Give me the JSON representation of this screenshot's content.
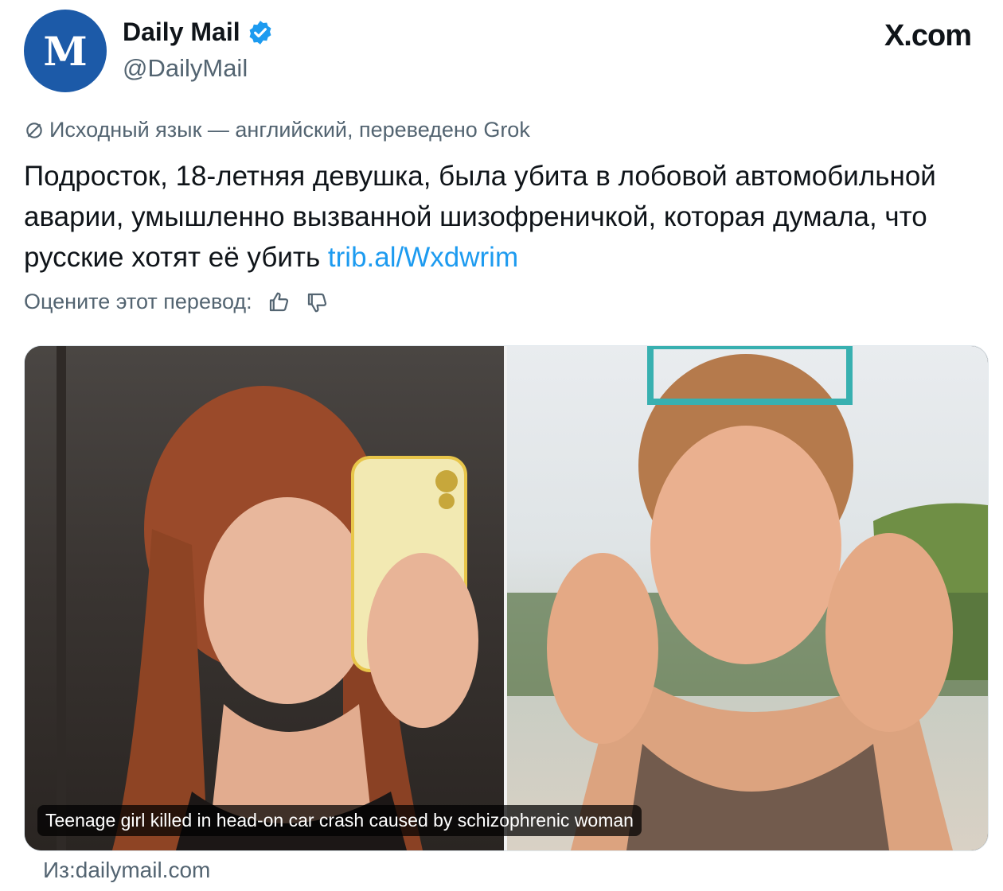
{
  "header": {
    "account_name": "Daily Mail",
    "handle": "@DailyMail",
    "avatar_letter": "M",
    "brand": "X.com",
    "verified_color": "#1d9bf0",
    "avatar_color": "#1c5aa8"
  },
  "tweet": {
    "translation_note": "Исходный язык — английский, переведено Grok",
    "text": "Подросток, 18-летняя девушка, была убита в лобовой автомобильной аварии, умышленно вызванной шизофреничкой, которая думала, что русские хотят её убить",
    "link": "trib.al/Wxdwrim",
    "link_color": "#1d9bf0",
    "rate_label": "Оцените этот перевод:",
    "rate_up_icon": "thumbs-up-icon",
    "rate_down_icon": "thumbs-down-icon"
  },
  "media": {
    "caption": "Teenage girl killed in head-on car crash caused by schizophrenic woman",
    "source": "Из:dailymail.com"
  }
}
